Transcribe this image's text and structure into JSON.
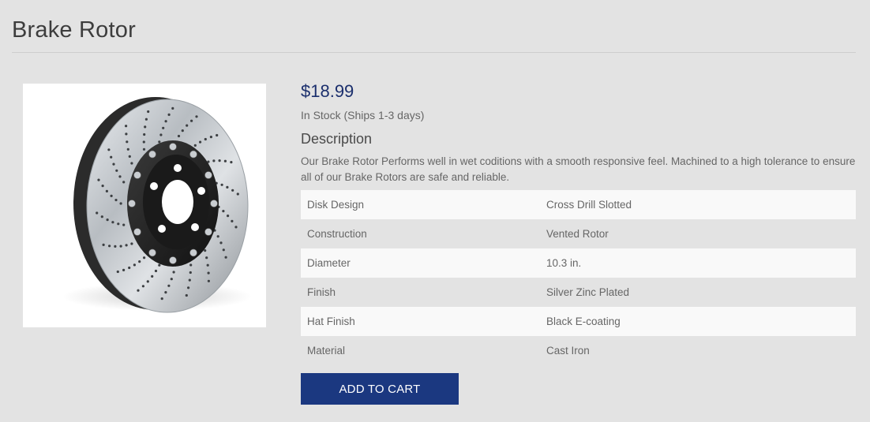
{
  "page": {
    "title": "Brake Rotor"
  },
  "product": {
    "image_alt": "brake-rotor-image",
    "price": "$18.99",
    "stock": "In Stock (Ships 1-3 days)",
    "description_heading": "Description",
    "description": "Our Brake Rotor Performs well in wet coditions with a smooth responsive feel. Machined to a high tolerance to ensure all of our Brake Rotors are safe and reliable.",
    "specs": [
      {
        "key": "Disk Design",
        "value": "Cross Drill Slotted"
      },
      {
        "key": "Construction",
        "value": "Vented Rotor"
      },
      {
        "key": "Diameter",
        "value": "10.3 in."
      },
      {
        "key": "Finish",
        "value": "Silver Zinc Plated"
      },
      {
        "key": "Hat Finish",
        "value": "Black E-coating"
      },
      {
        "key": "Material",
        "value": "Cast Iron"
      }
    ],
    "add_to_cart_label": "ADD TO CART"
  },
  "colors": {
    "background": "#e3e3e3",
    "price": "#1b2f6d",
    "button": "#1b3880",
    "row_stripe": "#f9f9f9"
  }
}
